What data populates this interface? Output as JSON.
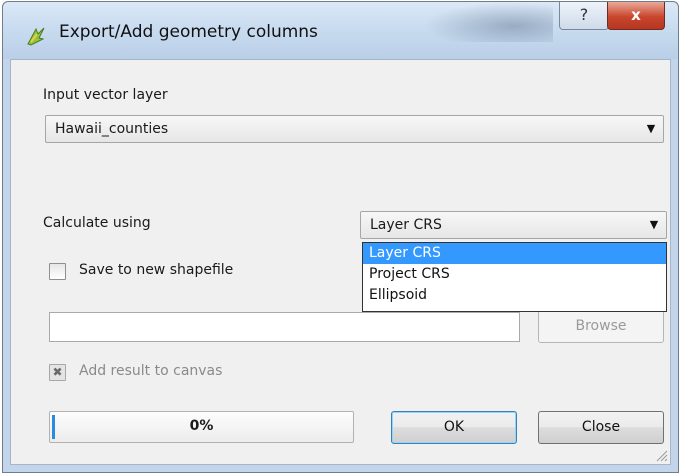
{
  "window": {
    "title": "Export/Add geometry columns",
    "help_glyph": "?",
    "close_glyph": "x"
  },
  "input_layer": {
    "label": "Input vector layer",
    "selected": "Hawaii_counties"
  },
  "calculate": {
    "label": "Calculate using",
    "selected": "Layer CRS",
    "options": [
      "Layer CRS",
      "Project CRS",
      "Ellipsoid"
    ],
    "highlighted_index": 0
  },
  "save_shapefile": {
    "label": "Save to new shapefile",
    "checked": false
  },
  "output_path": {
    "value": ""
  },
  "browse_button": "Browse",
  "add_to_canvas": {
    "label": "Add result to canvas",
    "checked": true,
    "enabled": false
  },
  "progress": {
    "text": "0%",
    "value": 0
  },
  "ok_button": "OK",
  "close_button": "Close",
  "colors": {
    "selection": "#3399ff",
    "progress": "#2b8be0",
    "close_button": "#c9462d"
  },
  "icons": {
    "app": "qgis-icon",
    "help": "help-icon",
    "close": "close-icon",
    "dropdown": "chevron-down-icon"
  }
}
